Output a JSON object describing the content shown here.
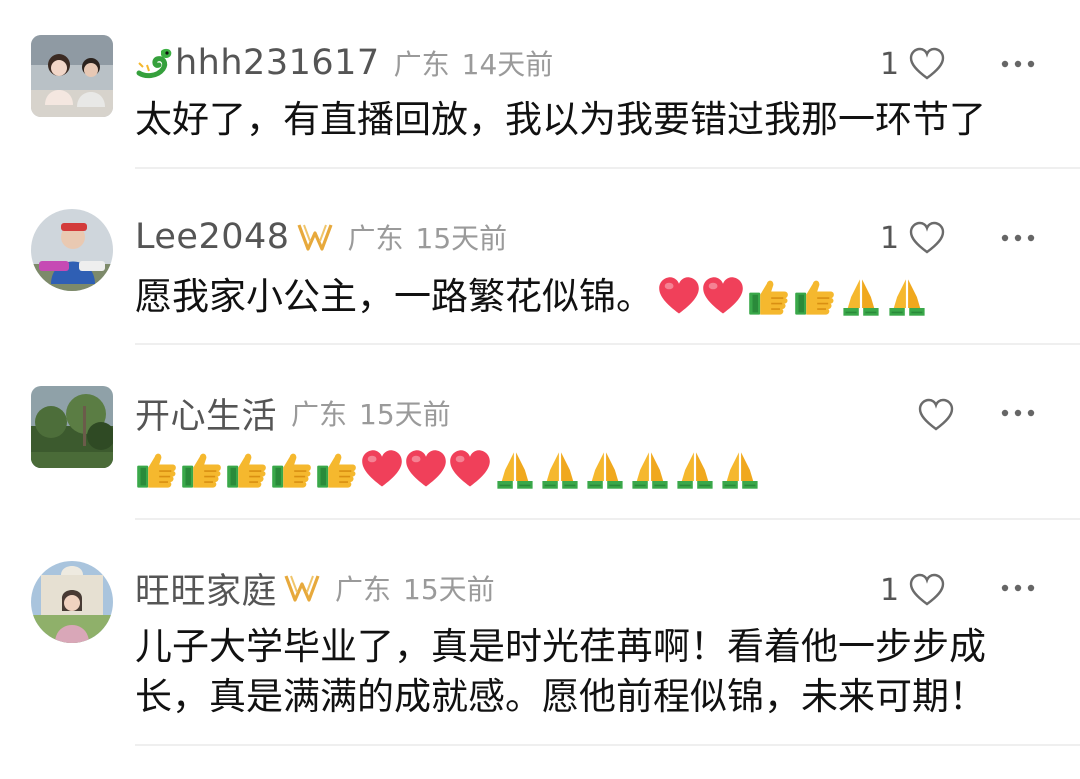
{
  "comments": [
    {
      "username": "hhh231617",
      "location": "广东",
      "time": "14天前",
      "likes": "1",
      "text": "太好了，有直播回放，我以为我要错过我那一环节了",
      "name_prefix_icon": "dragon-emoji-icon"
    },
    {
      "username": "Lee2048",
      "location": "广东",
      "time": "15天前",
      "likes": "1",
      "text": "愿我家小公主，一路繁花似锦。",
      "badge_icon": "vip-badge-icon",
      "emojis": [
        "heart",
        "heart",
        "thumbs-up",
        "thumbs-up",
        "pray",
        "pray"
      ]
    },
    {
      "username": "开心生活",
      "location": "广东",
      "time": "15天前",
      "likes": "",
      "emojis": [
        "thumbs-up",
        "thumbs-up",
        "thumbs-up",
        "thumbs-up",
        "thumbs-up",
        "heart",
        "heart",
        "heart",
        "pray",
        "pray",
        "pray",
        "pray",
        "pray",
        "pray"
      ]
    },
    {
      "username": "旺旺家庭",
      "location": "广东",
      "time": "15天前",
      "likes": "1",
      "badge_icon": "vip-badge-icon",
      "text_line1": "儿子大学毕业了，真是时光荏苒啊！看着他一步步成",
      "text_line2": "长，真是满满的成就感。愿他前程似锦，未来可期！"
    }
  ],
  "colors": {
    "username": "#555555",
    "meta": "#9a9a9a",
    "text": "#111111",
    "divider": "#efefef",
    "heart": "#f0405a",
    "thumbs": "#f5b82e",
    "cuff": "#3aa84a"
  }
}
